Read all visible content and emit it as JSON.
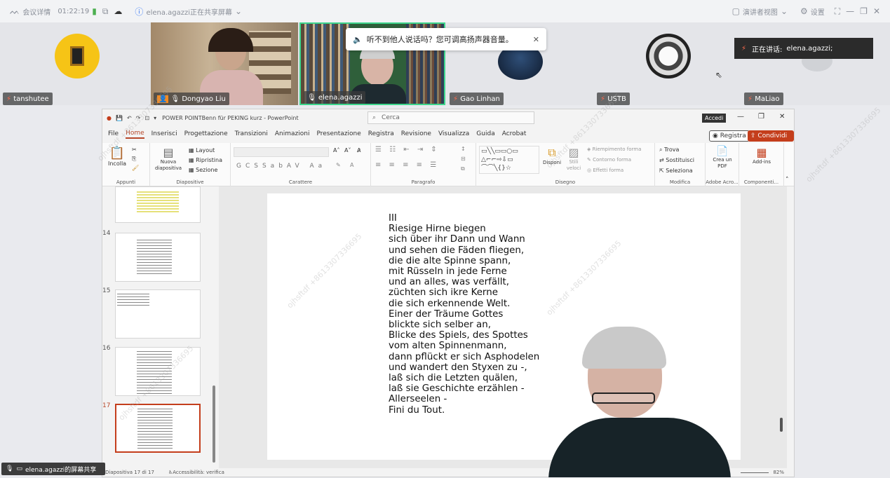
{
  "topbar": {
    "meeting_info": "会议详情",
    "timer": "01:22:19",
    "sharing_status": "elena.agazzi正在共享屏幕",
    "speaker_view": "演讲者视图",
    "settings": "设置"
  },
  "participants": [
    {
      "name": "tanshutee"
    },
    {
      "name": "Dongyao Liu"
    },
    {
      "name": "elena.agazzi"
    },
    {
      "name": "Gao Linhan"
    },
    {
      "name": "USTB"
    },
    {
      "name": "MaLiao"
    }
  ],
  "toast": {
    "message": "听不到他人说话吗？您可调高扬声器音量。"
  },
  "speaking": {
    "label": "正在讲话:",
    "name": "elena.agazzi;"
  },
  "ppt": {
    "doc_title": "POWER POINTBenn für PEKING kurz  -  PowerPoint",
    "search_placeholder": "Cerca",
    "accedi": "Accedi",
    "tabs": [
      "File",
      "Home",
      "Inserisci",
      "Progettazione",
      "Transizioni",
      "Animazioni",
      "Presentazione",
      "Registra",
      "Revisione",
      "Visualizza",
      "Guida",
      "Acrobat"
    ],
    "registra_button": "Registra",
    "condividi_button": "Condividi",
    "ribbon": {
      "incolla": "Incolla",
      "appunti": "Appunti",
      "nuova_diapositiva": "Nuova diapositiva",
      "layout": "Layout",
      "ripristina": "Ripristina",
      "sezione": "Sezione",
      "diapositive": "Diapositive",
      "carattere": "Carattere",
      "paragrafo": "Paragrafo",
      "disponi": "Disponi",
      "stili_veloci": "Stili veloci",
      "riempimento": "Riempimento forma",
      "contorno": "Contorno forma",
      "effetti": "Effetti forma",
      "disegno": "Disegno",
      "trova": "Trova",
      "sostituisci": "Sostituisci",
      "seleziona": "Seleziona",
      "modifica": "Modifica",
      "crea_pdf": "Crea un PDF",
      "adobe": "Adobe Acro...",
      "addins": "Add-ins",
      "componenti": "Componenti..."
    },
    "slide_numbers": [
      "14",
      "15",
      "16",
      "17"
    ],
    "poem_lines": [
      "III",
      "Riesige Hirne biegen",
      "sich über ihr Dann und Wann",
      "und sehen die Fäden fliegen,",
      "die die alte Spinne spann,",
      "mit Rüsseln in jede Ferne",
      "und an alles, was verfällt,",
      "züchten sich ikre Kerne",
      "die sich erkennende Welt.",
      "Einer der Träume Gottes",
      "blickte sich selber an,",
      "Blicke des Spiels, des Spottes",
      "vom alten Spinnenmann,",
      "dann pflückt er sich Asphodelen",
      "und wandert den Styxen zu -,",
      "laß sich die Letzten quälen,",
      "laß sie Geschichte erzählen -",
      "Allerseelen -",
      "Fini du Tout."
    ],
    "status_slide": "Diapositiva 17 di 17",
    "status_accessibility": "Accessibilità: verifica",
    "zoom": "82%"
  },
  "share_label": "elena.agazzi的屏幕共享",
  "watermark": "ojhsftdf +8613307336695"
}
